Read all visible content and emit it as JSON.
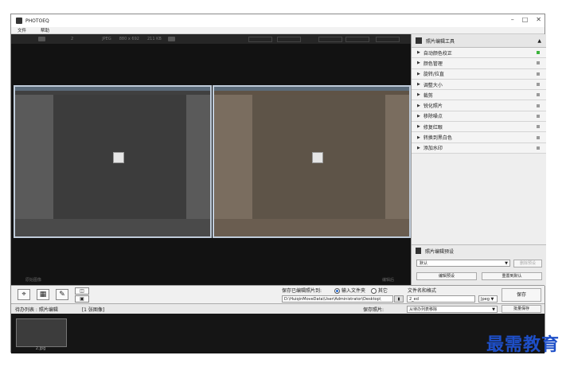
{
  "window": {
    "title": "PHOTOEQ",
    "min_icon": "minimize-icon",
    "max_icon": "maximize-icon",
    "close_icon": "close-icon"
  },
  "menu": [
    "文件",
    "帮助"
  ],
  "infobar": {
    "count": "2",
    "format": "JPEG",
    "dimensions": "880 x 692",
    "size": "211 KB"
  },
  "viewer": {
    "left_label": "原始图像",
    "right_label": "编辑后"
  },
  "sidebar": {
    "title": "照片编辑工具",
    "tools": [
      {
        "label": "自动颜色校正",
        "active": true
      },
      {
        "label": "颜色管理",
        "active": false
      },
      {
        "label": "旋转/拉直",
        "active": false
      },
      {
        "label": "调整大小",
        "active": false
      },
      {
        "label": "裁剪",
        "active": false
      },
      {
        "label": "锐化照片",
        "active": false
      },
      {
        "label": "移除噪点",
        "active": false
      },
      {
        "label": "修复红眼",
        "active": false
      },
      {
        "label": "转换到黑白色",
        "active": false
      },
      {
        "label": "添加水印",
        "active": false
      }
    ],
    "presets_title": "照片编辑预设",
    "preset_value": "默认",
    "delete_button": "删除预设",
    "edit_button": "编辑预设",
    "reset_button": "重置到默认"
  },
  "save": {
    "title": "保存已编辑照片到:",
    "option_input": "输入文件夹",
    "option_other": "其它",
    "path": "D:\\HuiqinMoveData\\User\\Administrator\\Desktop\\",
    "name_format_label": "文件名和格式",
    "name_value": "2_ed",
    "format": "Jpeg",
    "save_button": "保存"
  },
  "queue": {
    "label": "待办列表 : 照片编辑",
    "count": "[1 张图像]",
    "save_photos_label": "保存照片:",
    "save_photos_option": "从待办列表移除",
    "batch_save": "批量保存",
    "thumb_label": "2.jpg"
  },
  "watermark": "最需教育",
  "colors": {
    "active": "#3cb33c",
    "watermark": "#1e4fc8"
  }
}
